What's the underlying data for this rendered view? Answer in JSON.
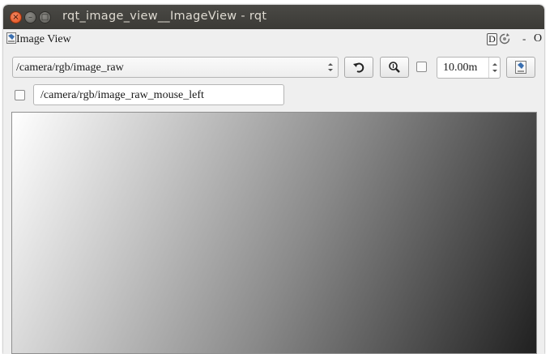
{
  "window": {
    "title": "rqt_image_view__ImageView - rqt",
    "close_glyph": "×",
    "min_glyph": "–",
    "max_glyph": "□"
  },
  "dock": {
    "title": "Image View",
    "help_label": "D",
    "minimize_label": "-",
    "close_label": "O"
  },
  "toolbar": {
    "topic": "/camera/rgb/image_raw",
    "refresh_icon": "refresh-icon",
    "zoom_icon": "zoom-icon",
    "smooth_checked": false,
    "rotation_value": "10.00m",
    "save_icon": "save-image-icon"
  },
  "mouse": {
    "publish_checked": false,
    "topic": "/camera/rgb/image_raw_mouse_left"
  },
  "image": {
    "description_colors": [
      "#ffffff",
      "#202020"
    ]
  }
}
